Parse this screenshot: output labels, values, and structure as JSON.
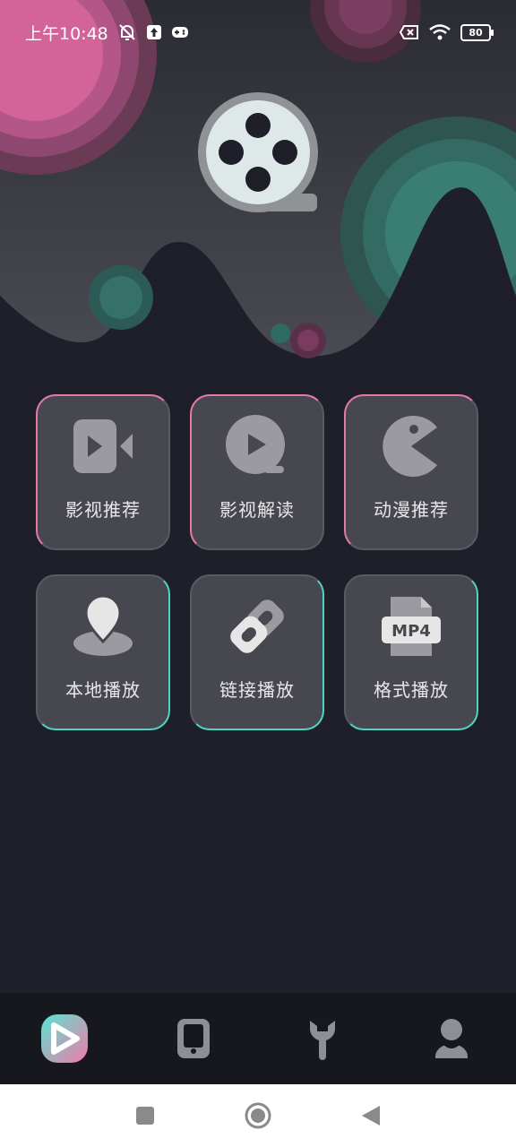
{
  "status_bar": {
    "time": "上午10:48",
    "battery": "80"
  },
  "theme": {
    "pink_accent": "#e47aa8",
    "teal_accent": "#4fd4c4",
    "card_bg": "#46474f",
    "page_bg": "#1e1f28",
    "icon_color": "#9a9aa0"
  },
  "features": [
    {
      "label": "影视推荐",
      "icon": "video-camera-icon"
    },
    {
      "label": "影视解读",
      "icon": "play-circle-icon"
    },
    {
      "label": "动漫推荐",
      "icon": "pacman-icon"
    },
    {
      "label": "本地播放",
      "icon": "location-pin-icon"
    },
    {
      "label": "链接播放",
      "icon": "link-icon"
    },
    {
      "label": "格式播放",
      "icon": "mp4-file-icon",
      "badge": "MP4"
    }
  ],
  "bottom_nav": [
    {
      "icon": "app-logo-play-icon",
      "active": true
    },
    {
      "icon": "phone-device-icon",
      "active": false
    },
    {
      "icon": "wrench-tool-icon",
      "active": false
    },
    {
      "icon": "user-profile-icon",
      "active": false
    }
  ],
  "system_nav": [
    {
      "icon": "recent-apps-icon"
    },
    {
      "icon": "home-circle-icon"
    },
    {
      "icon": "back-triangle-icon"
    }
  ]
}
